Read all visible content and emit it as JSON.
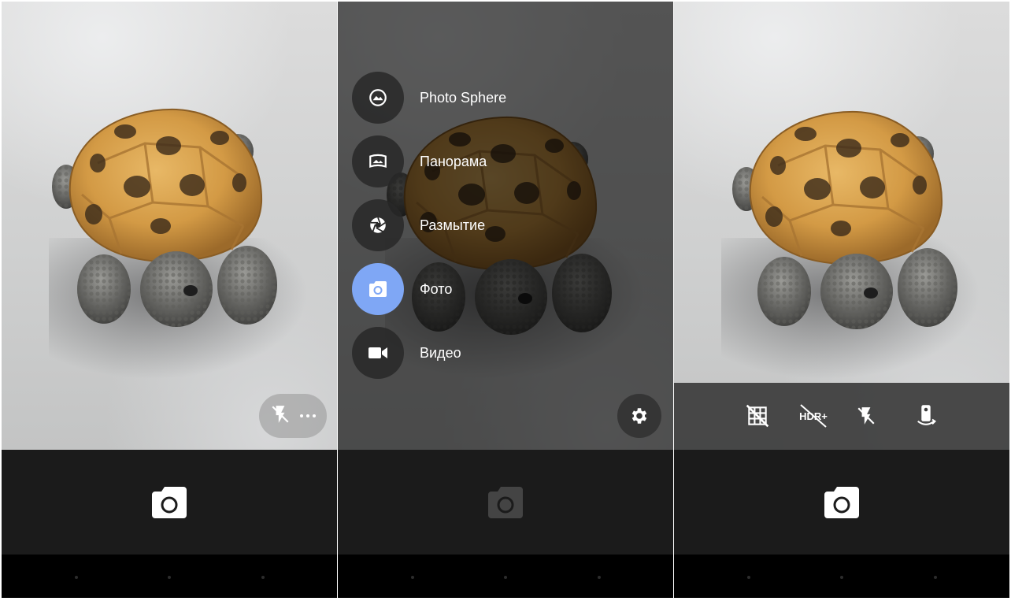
{
  "screens": [
    {
      "quick_settings": {
        "flash_icon": "flash-off-icon",
        "more_icon": "more-horizontal-icon"
      },
      "shutter": {
        "icon": "camera-shutter-icon"
      }
    },
    {
      "modes": [
        {
          "label": "Photo Sphere",
          "icon": "photo-sphere-icon",
          "active": false
        },
        {
          "label": "Панорама",
          "icon": "panorama-icon",
          "active": false
        },
        {
          "label": "Размытие",
          "icon": "lens-blur-icon",
          "active": false
        },
        {
          "label": "Фото",
          "icon": "camera-icon",
          "active": true
        },
        {
          "label": "Видео",
          "icon": "video-camera-icon",
          "active": false
        }
      ],
      "settings": {
        "icon": "gear-icon"
      },
      "shutter": {
        "icon": "camera-shutter-icon",
        "disabled": true
      }
    },
    {
      "options": {
        "grid": {
          "icon": "grid-off-icon"
        },
        "hdr": {
          "text": "HDR+",
          "icon": "hdr-off-icon"
        },
        "flash": {
          "icon": "flash-off-icon"
        },
        "switch_camera": {
          "icon": "switch-camera-icon"
        }
      },
      "shutter": {
        "icon": "camera-shutter-icon"
      }
    }
  ],
  "colors": {
    "active_mode": "#7fa7f5",
    "control_bar": "#1b1b1b"
  }
}
